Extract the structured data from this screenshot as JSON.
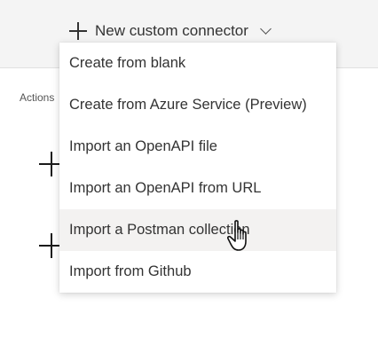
{
  "toolbar": {
    "new_connector_label": "New custom connector",
    "plus_icon": "plus-icon",
    "chevron_icon": "chevron-down-icon"
  },
  "background": {
    "actions_label": "Actions"
  },
  "dropdown": {
    "items": [
      {
        "label": "Create from blank"
      },
      {
        "label": "Create from Azure Service (Preview)"
      },
      {
        "label": "Import an OpenAPI file"
      },
      {
        "label": "Import an OpenAPI from URL"
      },
      {
        "label": "Import a Postman collection",
        "hovered": true
      },
      {
        "label": "Import from Github"
      }
    ]
  },
  "colors": {
    "command_bar_bg": "#f4f4f4",
    "menu_hover_bg": "#f3f2f1",
    "text": "#333333"
  },
  "cursor": "hand-pointer-icon"
}
